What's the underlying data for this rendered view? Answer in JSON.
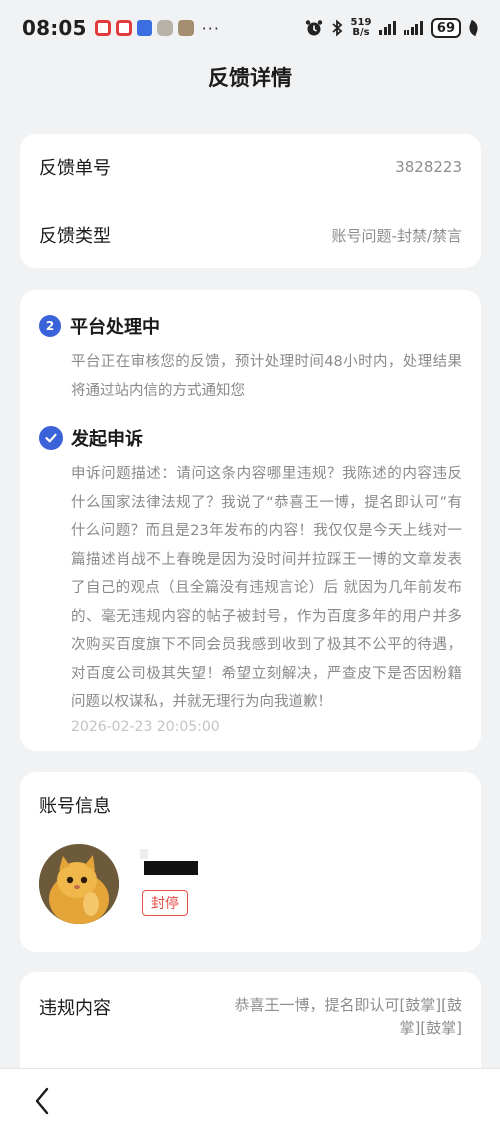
{
  "status_bar": {
    "time": "08:05",
    "notification_icons": [
      "app-red-icon",
      "app-red-icon",
      "app-blue-icon",
      "app-gray-icon",
      "app-tan-icon"
    ],
    "more": "···",
    "net_speed_value": "519",
    "net_speed_unit": "B/s",
    "battery": "69"
  },
  "header": {
    "title": "反馈详情"
  },
  "feedback": {
    "id_label": "反馈单号",
    "id_value": "3828223",
    "type_label": "反馈类型",
    "type_value": "账号问题-封禁/禁言"
  },
  "timeline": {
    "step2": {
      "index": "2",
      "title": "平台处理中",
      "desc": "平台正在审核您的反馈，预计处理时间48小时内，处理结果将通过站内信的方式通知您"
    },
    "step1": {
      "title": "发起申诉",
      "desc": "申诉问题描述：请问这条内容哪里违规？我陈述的内容违反什么国家法律法规了？我说了“恭喜王一博，提名即认可”有什么问题？而且是23年发布的内容！我仅仅是今天上线对一篇描述肖战不上春晚是因为没时间并拉踩王一博的文章发表了自己的观点（且全篇没有违规言论）后 就因为几年前发布的、毫无违规内容的帖子被封号，作为百度多年的用户并多次购买百度旗下不同会员我感到收到了极其不公平的待遇，对百度公司极其失望！希望立刻解决，严查皮下是否因粉籍问题以权谋私，并就无理行为向我道歉！",
      "time": "2026-02-23 20:05:00"
    }
  },
  "account": {
    "section_title": "账号信息",
    "status_tag": "封停"
  },
  "violation": {
    "label": "违规内容",
    "value": "恭喜王一博，提名即认可[鼓掌][鼓掌][鼓掌]"
  },
  "colors": {
    "accent": "#3a62d9",
    "danger": "#e55048",
    "muted_text": "#8a8a8a",
    "background": "#f1f2f4"
  }
}
